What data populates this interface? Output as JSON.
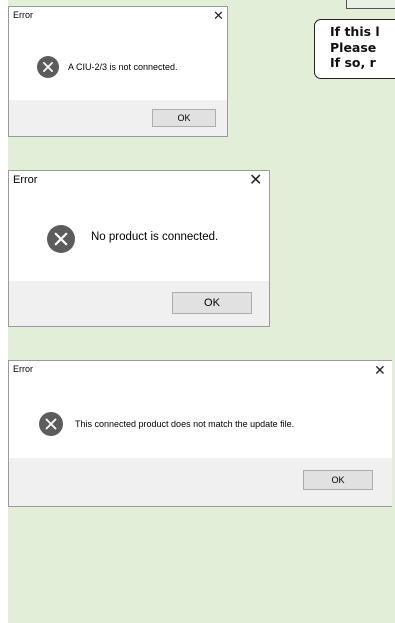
{
  "note": {
    "lines": [
      "If this l",
      "Please",
      "If so, r"
    ]
  },
  "dialogs": [
    {
      "title": "Error",
      "close_glyph": "✕",
      "icon": "error-circle-x-icon",
      "message": "A CIU-2/3 is not connected.",
      "ok_label": "OK"
    },
    {
      "title": "Error",
      "close_glyph": "✕",
      "icon": "error-circle-x-icon",
      "message": "No product is connected.",
      "ok_label": "OK"
    },
    {
      "title": "Error",
      "close_glyph": "✕",
      "icon": "error-circle-x-icon",
      "message": "This connected product does not match the update file.",
      "ok_label": "OK"
    }
  ],
  "colors": {
    "panel_background": "#e3eed8",
    "icon_fill": "#5c5c5c",
    "dialog_footer": "#f0f0f0",
    "button_face": "#e1e1e1"
  }
}
